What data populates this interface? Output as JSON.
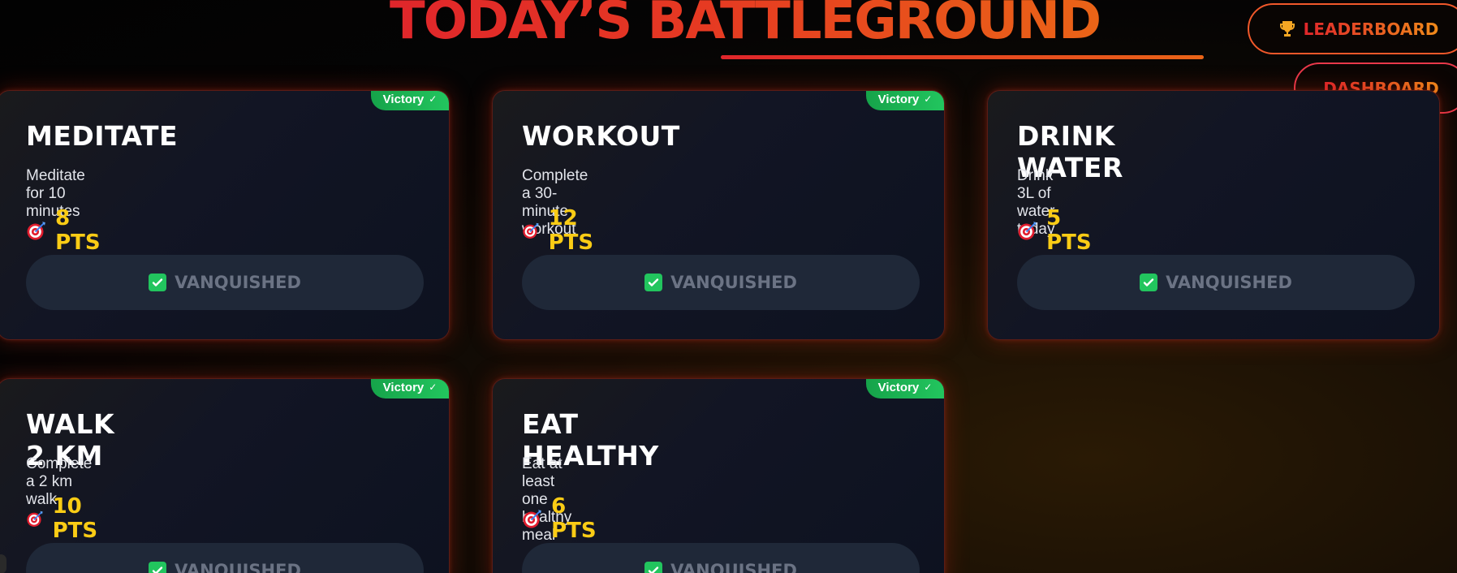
{
  "header": {
    "title": "TODAY’S BATTLEGROUND"
  },
  "nav": {
    "leaderboard_label": "LEADERBOARD",
    "dashboard_label": "DASHBOARD"
  },
  "tasks": [
    {
      "title": "MEDITATE",
      "description": "Meditate for 10 minutes",
      "points": "8 PTS",
      "badge": "Victory",
      "status": "VANQUISHED"
    },
    {
      "title": "WORKOUT",
      "description": "Complete a 30-minute workout",
      "points": "12 PTS",
      "badge": "Victory",
      "status": "VANQUISHED"
    },
    {
      "title": "DRINK WATER",
      "description": "Drink 3L of water today",
      "points": "5 PTS",
      "badge": "Victory",
      "status": "VANQUISHED"
    },
    {
      "title": "WALK 2 KM",
      "description": "Complete a 2 km walk",
      "points": "10 PTS",
      "badge": "Victory",
      "status": "VANQUISHED"
    },
    {
      "title": "EAT HEALTHY",
      "description": "Eat at least one healthy meal",
      "points": "6 PTS",
      "badge": "Victory",
      "status": "VANQUISHED"
    }
  ],
  "colors": {
    "accent_red": "#e0262b",
    "accent_orange": "#ea6417",
    "points_yellow": "#facc15",
    "victory_green": "#22c55e",
    "card_bg": "#121524",
    "button_bg": "#1f2838"
  },
  "icons": {
    "leaderboard": "trophy-icon",
    "points": "dart-target-icon",
    "status": "check-box-icon",
    "badge": "check-icon"
  }
}
